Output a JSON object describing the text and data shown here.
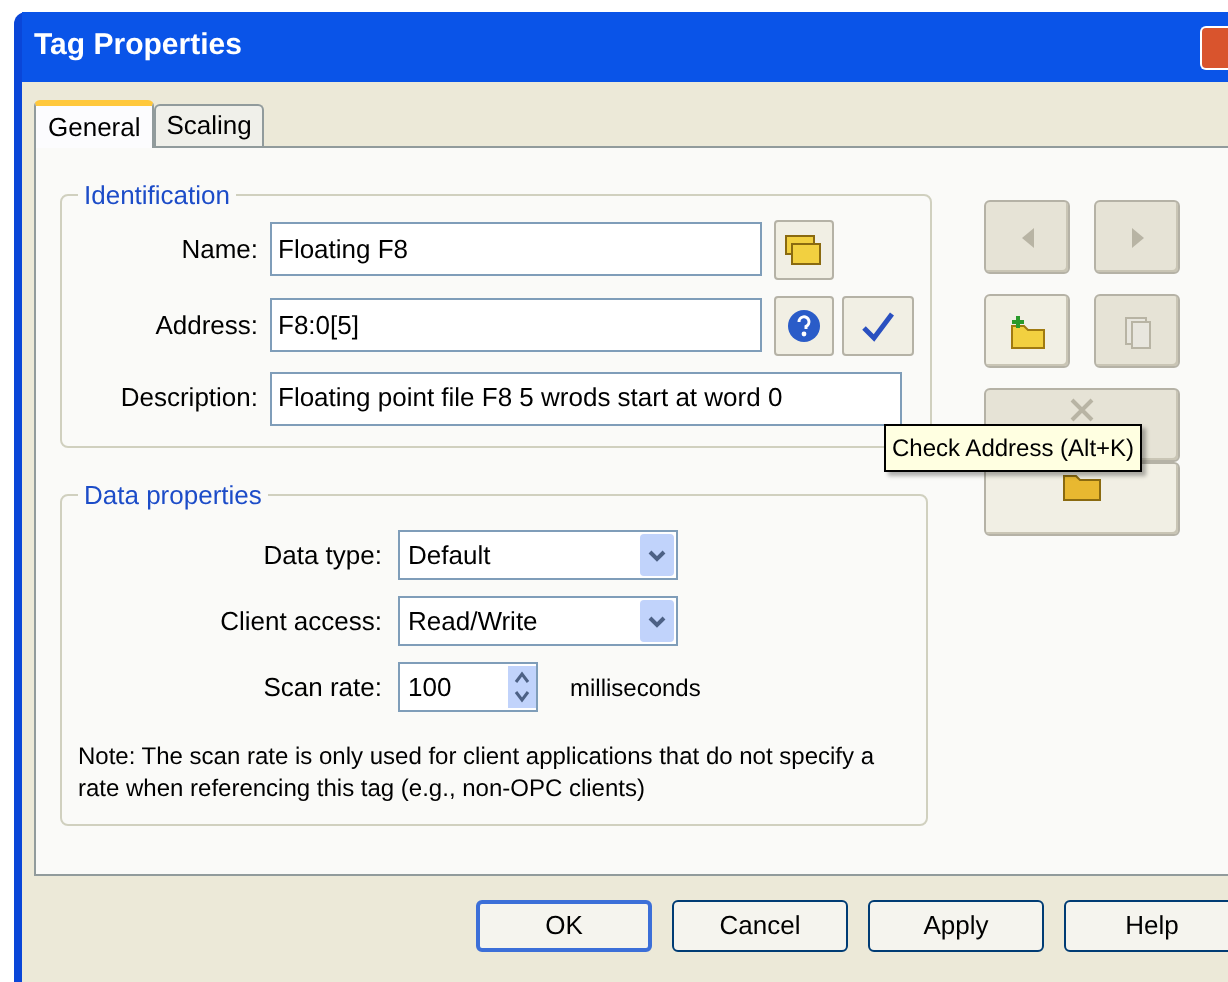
{
  "window": {
    "title": "Tag Properties"
  },
  "tabs": [
    {
      "label": "General",
      "selected": true
    },
    {
      "label": "Scaling",
      "selected": false
    }
  ],
  "identification": {
    "title": "Identification",
    "fields": [
      {
        "label": "Name:",
        "value": "Floating F8",
        "kind": "name"
      },
      {
        "label": "Address:",
        "value": "F8:0[5]",
        "kind": "address"
      },
      {
        "label": "Description:",
        "value": "Floating point file F8 5 wrods start at word 0",
        "kind": "plain"
      }
    ]
  },
  "side_buttons": [
    {
      "kind": "prev",
      "disabled": true
    },
    {
      "kind": "next",
      "disabled": true
    },
    {
      "kind": "new",
      "disabled": false
    },
    {
      "kind": "copy",
      "disabled": true
    },
    {
      "kind": "delete",
      "disabled": true
    },
    {
      "kind": "import",
      "disabled": false
    }
  ],
  "tooltip": "Check Address (Alt+K)",
  "data_properties": {
    "title": "Data properties",
    "data_type": {
      "label": "Data type:",
      "value": "Default"
    },
    "client_access": {
      "label": "Client access:",
      "value": "Read/Write"
    },
    "scan_rate": {
      "label": "Scan rate:",
      "value": "100",
      "unit": "milliseconds"
    },
    "note": "Note: The scan rate is only used for client applications that do not specify a rate when referencing this tag (e.g., non-OPC clients)"
  },
  "buttons": [
    {
      "label": "OK",
      "default": true
    },
    {
      "label": "Cancel",
      "default": false
    },
    {
      "label": "Apply",
      "default": false
    },
    {
      "label": "Help",
      "default": false
    }
  ]
}
